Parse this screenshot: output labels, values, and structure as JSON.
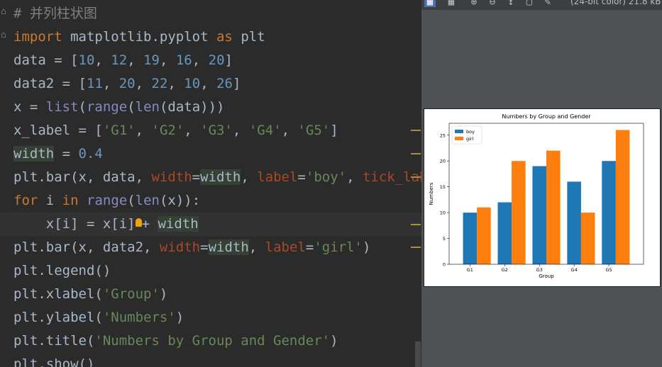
{
  "editor": {
    "lines": [
      {
        "html": "<span class=\"cmt\"># 并列柱状图</span>"
      },
      {
        "html": "<span class=\"kw\">import</span> matplotlib.pyplot <span class=\"kw\">as</span> plt"
      },
      {
        "html": "data = [<span class=\"num\">10</span>, <span class=\"num\">12</span>, <span class=\"num\">19</span>, <span class=\"num\">16</span>, <span class=\"num\">20</span>]"
      },
      {
        "html": "data2 = [<span class=\"num\">11</span>, <span class=\"num\">20</span>, <span class=\"num\">22</span>, <span class=\"num\">10</span>, <span class=\"num\">26</span>]"
      },
      {
        "html": "x = <span class=\"bi\">list</span>(<span class=\"bi\">range</span>(<span class=\"bi\">len</span>(data)))"
      },
      {
        "html": "x_label = [<span class=\"str\">'G1'</span>, <span class=\"str\">'G2'</span>, <span class=\"str\">'G3'</span>, <span class=\"str\">'G4'</span>, <span class=\"str\">'G5'</span>]"
      },
      {
        "html": "<span class=\"hl\">width</span> = <span class=\"num\">0.4</span>"
      },
      {
        "html": "plt.bar(x, data, <span class=\"par\">width</span>=<span class=\"hl\">width</span>, <span class=\"par\">label</span>=<span class=\"str\">'boy'</span>, <span class=\"par\">tick_label</span>=x_label)"
      },
      {
        "html": "<span class=\"kw\">for</span> i <span class=\"kw\">in</span> <span class=\"bi\">range</span>(<span class=\"bi\">len</span>(x)):"
      },
      {
        "html": "    x[i] = x[i]<span class=\"bulb\"></span>+ <span class=\"hl\">width</span>"
      },
      {
        "html": "plt.bar(x, data2, <span class=\"par\">width</span>=<span class=\"hl\">width</span>, <span class=\"par\">label</span>=<span class=\"str\">'girl'</span>)"
      },
      {
        "html": "plt.legend()"
      },
      {
        "html": "plt.xlabel(<span class=\"str\">'Group'</span>)"
      },
      {
        "html": "plt.ylabel(<span class=\"str\">'Numbers'</span>)"
      },
      {
        "html": "plt.title(<span class=\"str\">'Numbers by Group and Gender'</span>)"
      },
      {
        "html": "plt.show()"
      }
    ]
  },
  "viewer": {
    "info": "(24-bit color) 21.8 kB"
  },
  "colors": {
    "boy": "#1f77b4",
    "girl": "#ff7f0e"
  },
  "chart_data": {
    "type": "bar",
    "title": "Numbers by Group and Gender",
    "xlabel": "Group",
    "ylabel": "Numbers",
    "categories": [
      "G1",
      "G2",
      "G3",
      "G4",
      "G5"
    ],
    "series": [
      {
        "name": "boy",
        "values": [
          10,
          12,
          19,
          16,
          20
        ]
      },
      {
        "name": "girl",
        "values": [
          11,
          20,
          22,
          10,
          26
        ]
      }
    ],
    "ylim": [
      0,
      27.3
    ],
    "yticks": [
      0,
      5,
      10,
      15,
      20,
      25
    ],
    "legend": "top-left",
    "grid": false
  }
}
